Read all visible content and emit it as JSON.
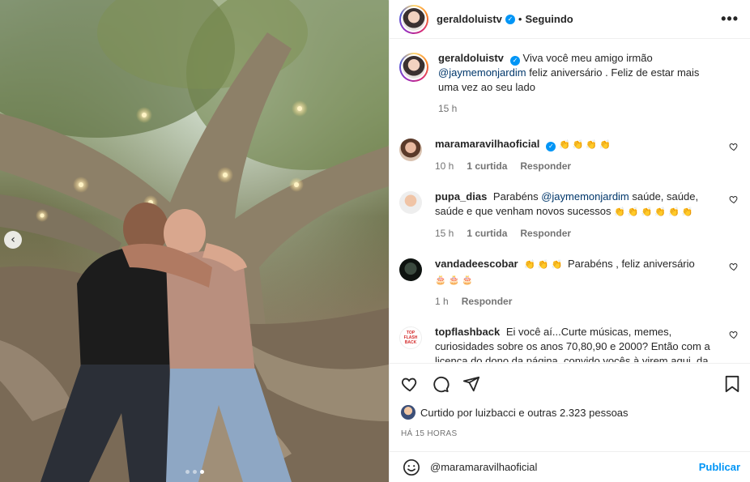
{
  "post": {
    "author": "geraldoluistv",
    "separator": "•",
    "follow_status": "Seguindo",
    "more_label": "•••"
  },
  "caption": {
    "user": "geraldoluistv",
    "text_before": "Viva você meu amigo irmão",
    "mention": "@jaymemonjardim",
    "text_after": "feliz aniversário . Feliz de estar mais uma vez ao seu lado",
    "time": "15 h"
  },
  "comments": [
    {
      "user": "maramaravilhaoficial",
      "verified": true,
      "text": "",
      "emoji": "👏👏👏👏",
      "time": "10 h",
      "likes": "1 curtida",
      "reply": "Responder"
    },
    {
      "user": "pupa_dias",
      "text_before": "Parabéns",
      "mention": "@jaymemonjardim",
      "text_after": "saúde, saúde, saúde e que venham novos sucessos",
      "emoji": "👏👏👏👏👏👏",
      "time": "15 h",
      "likes": "1 curtida",
      "reply": "Responder"
    },
    {
      "user": "vandadeescobar",
      "emoji_before": "👏👏👏",
      "text": "Parabéns , feliz aniversário",
      "emoji": "🎂🎂🎂",
      "time": "1 h",
      "reply": "Responder"
    },
    {
      "user": "topflashback",
      "avatar_text": "TOP FLASH BACK",
      "text": "Ei você aí...Curte músicas, memes, curiosidades sobre os anos 70,80,90 e 2000? Então com a licença do dono da página, convido vocês à virem aqui, da uma olhadinha no meu perfil. Espero que gostem.",
      "emoji": "🎵🎧📺"
    }
  ],
  "likes": {
    "text": "Curtido por luizbacci e outras 2.323 pessoas"
  },
  "timestamp": "HÁ 15 HORAS",
  "composer": {
    "value": "@maramaravilhaoficial",
    "submit": "Publicar"
  },
  "carousel": {
    "prev_icon": "chevron-left-icon",
    "slides": 3,
    "active_slide": 3
  },
  "colors": {
    "accent": "#0095f6",
    "mention": "#00376b",
    "meta": "#737373"
  }
}
